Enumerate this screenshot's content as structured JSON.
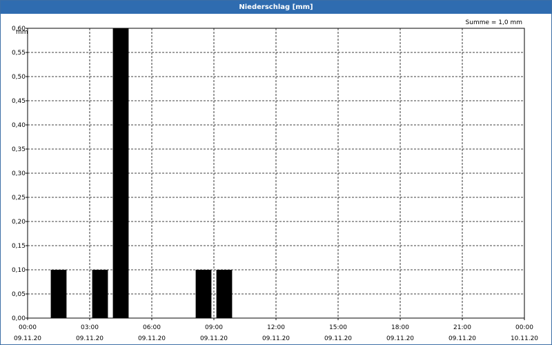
{
  "window": {
    "title": "Niederschlag [mm]"
  },
  "chart_data": {
    "type": "bar",
    "title": "Niederschlag [mm]",
    "ylabel": "mm",
    "xlabel": "",
    "annotation": "Summe = 1,0 mm",
    "ylim": [
      0,
      0.6
    ],
    "y_ticks": [
      "0,00",
      "0,05",
      "0,10",
      "0,15",
      "0,20",
      "0,25",
      "0,30",
      "0,35",
      "0,40",
      "0,45",
      "0,50",
      "0,55",
      "0,60"
    ],
    "x_range_hours": [
      0,
      24
    ],
    "x_ticks": [
      {
        "time": "00:00",
        "date": "09.11.20"
      },
      {
        "time": "03:00",
        "date": "09.11.20"
      },
      {
        "time": "06:00",
        "date": "09.11.20"
      },
      {
        "time": "09:00",
        "date": "09.11.20"
      },
      {
        "time": "12:00",
        "date": "09.11.20"
      },
      {
        "time": "15:00",
        "date": "09.11.20"
      },
      {
        "time": "18:00",
        "date": "09.11.20"
      },
      {
        "time": "21:00",
        "date": "09.11.20"
      },
      {
        "time": "00:00",
        "date": "10.11.20"
      }
    ],
    "bars": [
      {
        "start": "01:00",
        "end": "02:00",
        "value": 0.1
      },
      {
        "start": "03:00",
        "end": "04:00",
        "value": 0.1
      },
      {
        "start": "04:00",
        "end": "05:00",
        "value": 0.6
      },
      {
        "start": "08:00",
        "end": "09:00",
        "value": 0.1
      },
      {
        "start": "09:00",
        "end": "10:00",
        "value": 0.1
      }
    ],
    "grid": true,
    "colors": {
      "bar": "#000000",
      "title_bar": "#2f6cb0",
      "grid": "#000000"
    }
  }
}
